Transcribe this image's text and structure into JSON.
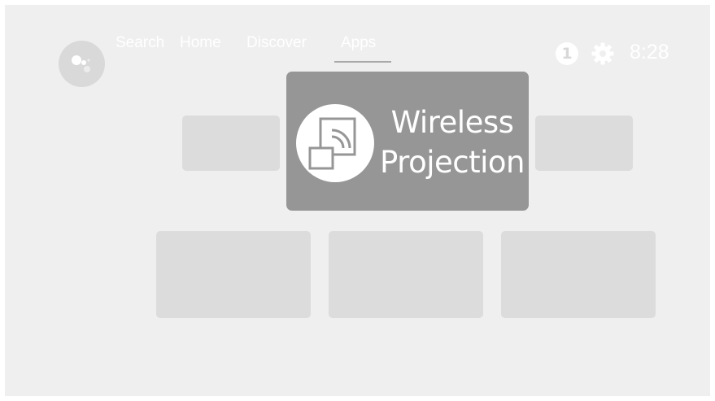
{
  "nav": {
    "items": [
      {
        "label": "Search"
      },
      {
        "label": "Home"
      },
      {
        "label": "Discover"
      },
      {
        "label": "Apps"
      }
    ],
    "active": "Apps"
  },
  "status": {
    "notification_count": "1",
    "time": "8:28"
  },
  "feature_card": {
    "title_line1": "Wireless",
    "title_line2": "Projection",
    "icon": "cast-icon"
  },
  "icons": {
    "assistant": "assistant-icon",
    "settings": "gear-icon",
    "notification": "notification-badge"
  },
  "colors": {
    "background": "#efefef",
    "tile": "#dcdcdc",
    "focused_card": "#969696",
    "text": "#ffffff"
  }
}
